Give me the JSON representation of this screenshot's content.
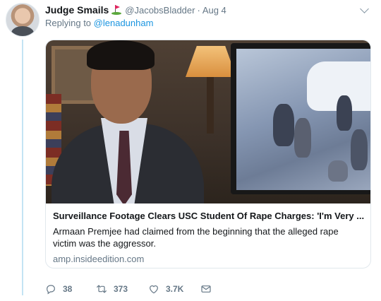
{
  "tweet": {
    "display_name": "Judge Smails",
    "handle": "@JacobsBladder",
    "separator": "·",
    "time": "Aug 4",
    "reply_prefix": "Replying to",
    "reply_to": "@lenadunham"
  },
  "card": {
    "title": "Surveillance Footage Clears USC Student Of Rape Charges: 'I'm Very ...",
    "description": "Armaan Premjee had claimed from the beginning that the alleged rape victim was the aggressor.",
    "domain": "amp.insideedition.com"
  },
  "actions": {
    "replies": "38",
    "retweets": "373",
    "likes": "3.7K"
  },
  "icons": {
    "badge": "golf-flag-icon",
    "menu": "chevron-down-icon",
    "reply": "reply-icon",
    "retweet": "retweet-icon",
    "like": "heart-icon",
    "dm": "envelope-icon"
  },
  "colors": {
    "link": "#1b95e0",
    "muted": "#657786",
    "thread_line": "#c4e4f4"
  }
}
